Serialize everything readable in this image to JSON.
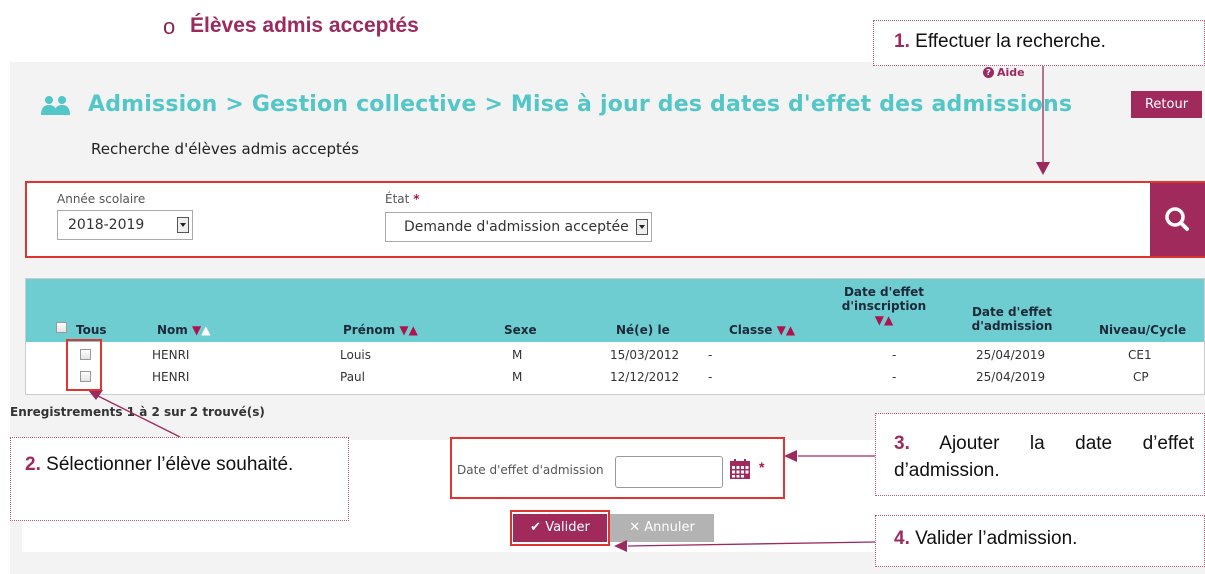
{
  "doc": {
    "bullet": "o",
    "heading": "Élèves admis acceptés"
  },
  "header": {
    "title": "Admission > Gestion collective > Mise à jour des dates d'effet des admissions",
    "help": "Aide",
    "back": "Retour",
    "section": "Recherche d'élèves admis acceptés"
  },
  "search": {
    "year_label": "Année scolaire",
    "year_value": "2018-2019",
    "state_label": "État",
    "state_required": "*",
    "state_value": "Demande d'admission acceptée"
  },
  "table": {
    "headers": {
      "all": "Tous",
      "nom": "Nom",
      "prenom": "Prénom",
      "sexe": "Sexe",
      "ne": "Né(e) le",
      "classe": "Classe",
      "inscription_l1": "Date d'effet",
      "inscription_l2": "d'inscription",
      "admission_l1": "Date d'effet",
      "admission_l2": "d'admission",
      "niveau": "Niveau/Cycle"
    },
    "rows": [
      {
        "nom": "HENRI",
        "prenom": "Louis",
        "sexe": "M",
        "ne": "15/03/2012",
        "classe": "-",
        "inscription": "-",
        "admission": "25/04/2019",
        "niveau": "CE1"
      },
      {
        "nom": "HENRI",
        "prenom": "Paul",
        "sexe": "M",
        "ne": "12/12/2012",
        "classe": "-",
        "inscription": "-",
        "admission": "25/04/2019",
        "niveau": "CP"
      }
    ],
    "records": "Enregistrements 1 à 2 sur 2 trouvé(s)"
  },
  "form": {
    "date_label": "Date d'effet d'admission",
    "date_value": "",
    "required": "*",
    "validate": "Valider",
    "cancel": "Annuler"
  },
  "callouts": {
    "c1_num": "1.",
    "c1_text": "Effectuer la recherche.",
    "c2_num": "2.",
    "c2_text": "Sélectionner l’élève souhaité.",
    "c3_num": "3.",
    "c3_text": "Ajouter la date d’effet d’admission.",
    "c4_num": "4.",
    "c4_text": "Valider l’admission."
  },
  "colors": {
    "accent": "#a02a5c",
    "title": "#53c6c8",
    "table_header": "#6ecdd1",
    "highlight": "#e0342e"
  }
}
